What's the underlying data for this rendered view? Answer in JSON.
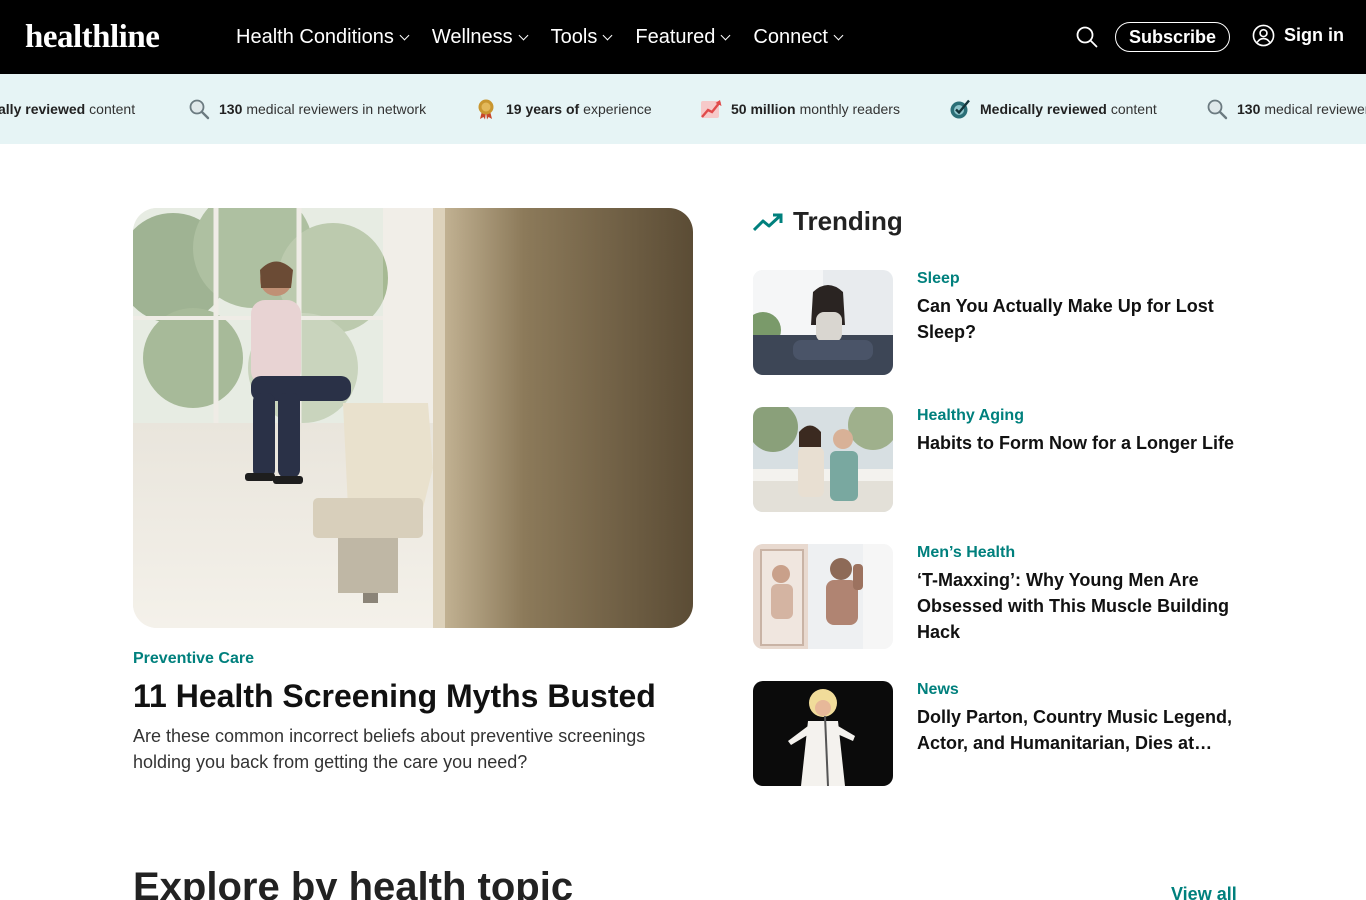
{
  "header": {
    "logo": "healthline",
    "nav": [
      "Health Conditions",
      "Wellness",
      "Tools",
      "Featured",
      "Connect"
    ],
    "subscribe": "Subscribe",
    "sign_in": "Sign in"
  },
  "stats": [
    {
      "bold": "ally reviewed",
      "rest": "content",
      "icon": "check-badge-icon"
    },
    {
      "bold": "130",
      "rest": "medical reviewers in network",
      "icon": "magnifier-icon"
    },
    {
      "bold": "19 years of",
      "rest": "experience",
      "icon": "award-medal-icon"
    },
    {
      "bold": "50 million",
      "rest": "monthly readers",
      "icon": "growth-chart-icon"
    },
    {
      "bold": "Medically reviewed",
      "rest": "content",
      "icon": "check-badge-icon"
    },
    {
      "bold": "130",
      "rest": "medical reviewer",
      "icon": "magnifier-icon"
    }
  ],
  "featured": {
    "category": "Preventive Care",
    "title": "11 Health Screening Myths Busted",
    "description": "Are these common incorrect beliefs about preventive screenings holding you back from getting the care you need?"
  },
  "trending": {
    "heading": "Trending",
    "items": [
      {
        "category": "Sleep",
        "title": "Can You Actually Make Up for Lost Sleep?"
      },
      {
        "category": "Healthy Aging",
        "title": "Habits to Form Now for a Longer Life"
      },
      {
        "category": "Men’s Health",
        "title": "‘T-Maxxing’: Why Young Men Are Obsessed with This Muscle Building Hack"
      },
      {
        "category": "News",
        "title": "Dolly Parton, Country Music Legend, Actor, and Humanitarian, Dies at…"
      }
    ]
  },
  "explore": {
    "title": "Explore by health topic",
    "view_all": "View all"
  },
  "colors": {
    "accent": "#00807d",
    "header_bg": "#000000",
    "ticker_bg": "#e6f4f5"
  }
}
